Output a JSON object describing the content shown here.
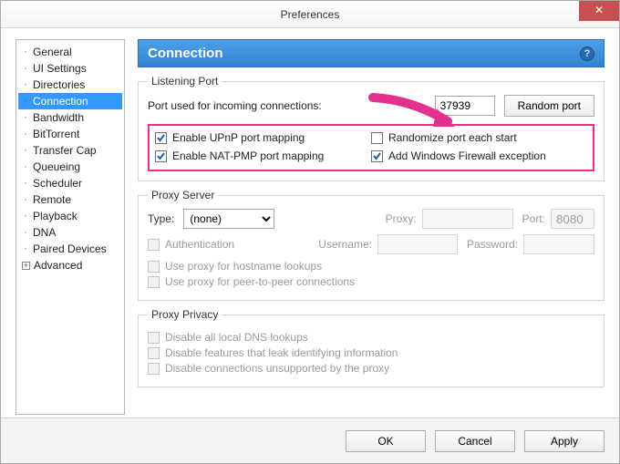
{
  "window": {
    "title": "Preferences"
  },
  "sidebar": {
    "items": [
      {
        "label": "General"
      },
      {
        "label": "UI Settings"
      },
      {
        "label": "Directories"
      },
      {
        "label": "Connection",
        "selected": true
      },
      {
        "label": "Bandwidth"
      },
      {
        "label": "BitTorrent"
      },
      {
        "label": "Transfer Cap"
      },
      {
        "label": "Queueing"
      },
      {
        "label": "Scheduler"
      },
      {
        "label": "Remote"
      },
      {
        "label": "Playback"
      },
      {
        "label": "DNA"
      },
      {
        "label": "Paired Devices"
      },
      {
        "label": "Advanced",
        "expander": true
      }
    ]
  },
  "section": {
    "title": "Connection"
  },
  "listening": {
    "legend": "Listening Port",
    "port_label": "Port used for incoming connections:",
    "port_value": "37939",
    "random_btn": "Random port",
    "upnp": "Enable UPnP port mapping",
    "natpmp": "Enable NAT-PMP port mapping",
    "randomize": "Randomize port each start",
    "firewall": "Add Windows Firewall exception"
  },
  "proxy": {
    "legend": "Proxy Server",
    "type_label": "Type:",
    "type_value": "(none)",
    "proxy_label": "Proxy:",
    "port_label": "Port:",
    "port_value": "8080",
    "auth": "Authentication",
    "user_label": "Username:",
    "pass_label": "Password:",
    "hostlookup": "Use proxy for hostname lookups",
    "p2p": "Use proxy for peer-to-peer connections"
  },
  "privacy": {
    "legend": "Proxy Privacy",
    "dns": "Disable all local DNS lookups",
    "leak": "Disable features that leak identifying information",
    "conn": "Disable connections unsupported by the proxy"
  },
  "footer": {
    "ok": "OK",
    "cancel": "Cancel",
    "apply": "Apply"
  }
}
